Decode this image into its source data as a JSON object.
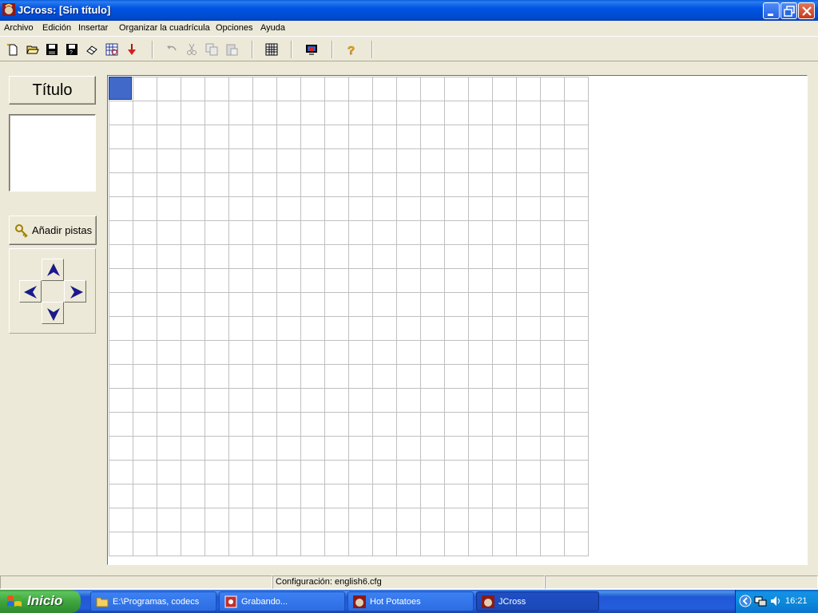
{
  "window": {
    "title": "JCross: [Sin título]"
  },
  "menu": {
    "items": [
      "Archivo",
      "Edición",
      "Insertar",
      "Organizar la cuadrícula",
      "Opciones",
      "Ayuda"
    ]
  },
  "toolbar": {
    "buttons": [
      "new-file-icon",
      "open-folder-icon",
      "save-icon",
      "save-as-icon",
      "eraser-icon",
      "web-page-icon",
      "export-arrow-icon",
      "undo-icon",
      "cut-icon",
      "copy-icon",
      "paste-icon",
      "grid-icon",
      "screen-icon",
      "help-icon"
    ]
  },
  "left_panel": {
    "title_button": "Título",
    "title_value": "",
    "add_clues_button": "Añadir pistas"
  },
  "grid": {
    "rows": 20,
    "cols": 20,
    "selected_cell": [
      0,
      0
    ]
  },
  "status": {
    "left": "",
    "config": "Configuración: english6.cfg",
    "right": ""
  },
  "taskbar": {
    "start_label": "Inicio",
    "tasks": [
      "E:\\Programas, codecs",
      "Grabando...",
      "Hot Potatoes",
      "JCross"
    ],
    "active_task": "JCross",
    "clock": "16:21"
  },
  "colors": {
    "titlebar": "#0054e3",
    "selected_cell": "#4169c9",
    "window_bg": "#ece9d8"
  }
}
